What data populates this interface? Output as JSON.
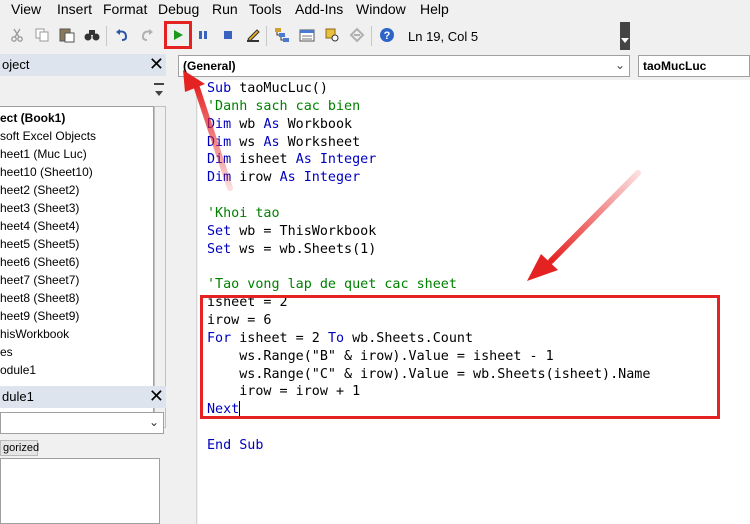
{
  "menu": [
    "View",
    "Insert",
    "Format",
    "Debug",
    "Run",
    "Tools",
    "Add-Ins",
    "Window",
    "Help"
  ],
  "toolbar": {
    "status": "Ln 19, Col 5",
    "icons": [
      "cut-icon",
      "copy-icon",
      "paste-icon",
      "find-icon",
      "undo-icon",
      "redo-icon",
      "run-icon",
      "break-icon",
      "reset-icon",
      "design-mode-icon",
      "project-explorer-icon",
      "properties-icon",
      "object-browser-icon",
      "toolbox-icon",
      "help-icon"
    ]
  },
  "project_pane": {
    "title": "oject",
    "items": [
      "ect (Book1)",
      "soft Excel Objects",
      "heet1 (Muc Luc)",
      "heet10 (Sheet10)",
      "heet2 (Sheet2)",
      "heet3 (Sheet3)",
      "heet4 (Sheet4)",
      "heet5 (Sheet5)",
      "heet6 (Sheet6)",
      "heet7 (Sheet7)",
      "heet8 (Sheet8)",
      "heet9 (Sheet9)",
      "hisWorkbook",
      "es",
      "odule1"
    ]
  },
  "properties_pane": {
    "title": "dule1",
    "tab": "gorized"
  },
  "code_window": {
    "object_combo": "(General)",
    "proc_combo": "taoMucLuc",
    "lines": [
      [
        {
          "t": "Sub ",
          "c": "kw"
        },
        {
          "t": "taoMucLuc()"
        }
      ],
      [
        {
          "t": "'Danh sach cac bien",
          "c": "cm"
        }
      ],
      [
        {
          "t": "Dim ",
          "c": "kw"
        },
        {
          "t": "wb "
        },
        {
          "t": "As ",
          "c": "kw"
        },
        {
          "t": "Workbook"
        }
      ],
      [
        {
          "t": "Dim ",
          "c": "kw"
        },
        {
          "t": "ws "
        },
        {
          "t": "As ",
          "c": "kw"
        },
        {
          "t": "Worksheet"
        }
      ],
      [
        {
          "t": "Dim ",
          "c": "kw"
        },
        {
          "t": "isheet "
        },
        {
          "t": "As ",
          "c": "kw"
        },
        {
          "t": "Integer",
          "c": "kw"
        }
      ],
      [
        {
          "t": "Dim ",
          "c": "kw"
        },
        {
          "t": "irow "
        },
        {
          "t": "As ",
          "c": "kw"
        },
        {
          "t": "Integer",
          "c": "kw"
        }
      ],
      [],
      [
        {
          "t": "'Khoi tao",
          "c": "cm"
        }
      ],
      [
        {
          "t": "Set ",
          "c": "kw"
        },
        {
          "t": "wb = ThisWorkbook"
        }
      ],
      [
        {
          "t": "Set ",
          "c": "kw"
        },
        {
          "t": "ws = wb.Sheets(1)"
        }
      ],
      [],
      [
        {
          "t": "'Tao vong lap de quet cac sheet",
          "c": "cm"
        }
      ],
      [
        {
          "t": "isheet = 2"
        }
      ],
      [
        {
          "t": "irow = 6"
        }
      ],
      [
        {
          "t": "For ",
          "c": "kw"
        },
        {
          "t": "isheet = 2 "
        },
        {
          "t": "To ",
          "c": "kw"
        },
        {
          "t": "wb.Sheets.Count"
        }
      ],
      [
        {
          "t": "    ws.Range(\"B\" & irow).Value = isheet - 1"
        }
      ],
      [
        {
          "t": "    ws.Range(\"C\" & irow).Value = wb.Sheets(isheet).Name"
        }
      ],
      [
        {
          "t": "    irow = irow + 1"
        }
      ],
      [
        {
          "t": "Next",
          "c": "kw"
        },
        {
          "t": "",
          "caret": true
        }
      ],
      [],
      [
        {
          "t": "End Sub",
          "c": "kw"
        }
      ]
    ]
  },
  "colors": {
    "keyword": "#0000c0",
    "comment": "#008000",
    "highlight": "#e52222"
  }
}
